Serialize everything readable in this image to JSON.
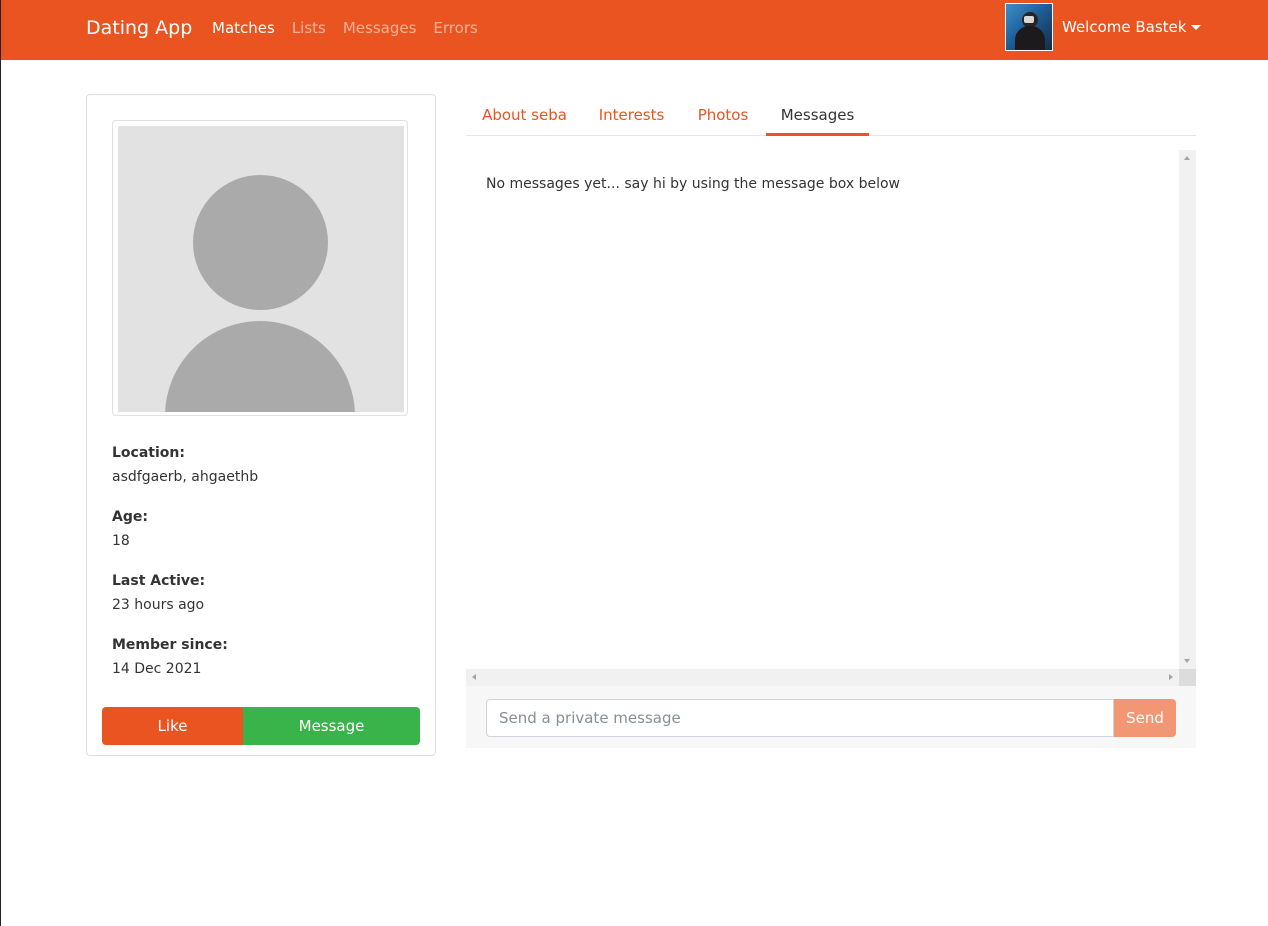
{
  "navbar": {
    "brand": "Dating App",
    "links": [
      {
        "label": "Matches",
        "active": true
      },
      {
        "label": "Lists",
        "active": false
      },
      {
        "label": "Messages",
        "active": false
      },
      {
        "label": "Errors",
        "active": false
      }
    ],
    "welcome": "Welcome Bastek",
    "brand_color": "#e95420"
  },
  "profile": {
    "fields": [
      {
        "label": "Location:",
        "value": "asdfgaerb, ahgaethb"
      },
      {
        "label": "Age:",
        "value": "18"
      },
      {
        "label": "Last Active:",
        "value": "23 hours ago"
      },
      {
        "label": "Member since:",
        "value": "14 Dec 2021"
      }
    ],
    "like_label": "Like",
    "message_label": "Message"
  },
  "tabs": [
    {
      "label": "About seba",
      "active": false
    },
    {
      "label": "Interests",
      "active": false
    },
    {
      "label": "Photos",
      "active": false
    },
    {
      "label": "Messages",
      "active": true
    }
  ],
  "messages": {
    "empty_text": "No messages yet... say hi by using the message box below",
    "input_placeholder": "Send a private message",
    "send_label": "Send"
  }
}
